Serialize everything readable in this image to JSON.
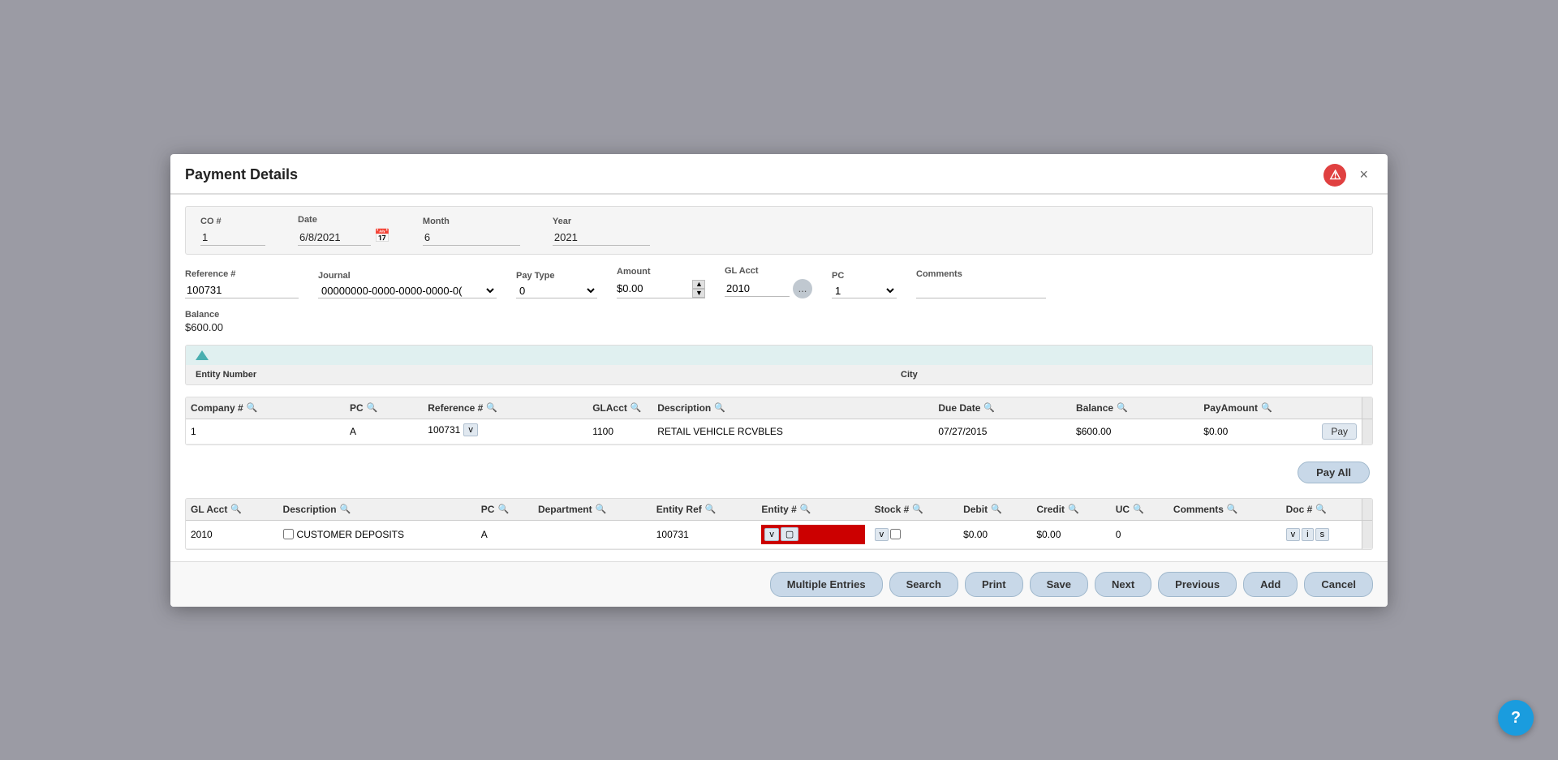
{
  "modal": {
    "title": "Payment Details",
    "close_label": "×"
  },
  "top_info": {
    "co_label": "CO #",
    "co_value": "1",
    "date_label": "Date",
    "date_value": "6/8/2021",
    "month_label": "Month",
    "month_value": "6",
    "year_label": "Year",
    "year_value": "2021"
  },
  "form": {
    "reference_label": "Reference #",
    "reference_value": "100731",
    "journal_label": "Journal",
    "journal_value": "00000000-0000-0000-0000-0(",
    "pay_type_label": "Pay Type",
    "pay_type_value": "0",
    "amount_label": "Amount",
    "amount_value": "$0.00",
    "gl_acct_label": "GL Acct",
    "gl_acct_value": "2010",
    "dots_label": "...",
    "pc_label": "PC",
    "pc_value": "1",
    "comments_label": "Comments",
    "comments_value": "",
    "balance_label": "Balance",
    "balance_value": "$600.00"
  },
  "entity_panel": {
    "entity_number_label": "Entity Number",
    "city_label": "City"
  },
  "top_table": {
    "columns": [
      {
        "key": "company_hash",
        "label": "Company #"
      },
      {
        "key": "pc",
        "label": "PC"
      },
      {
        "key": "reference_hash",
        "label": "Reference #"
      },
      {
        "key": "gl_acct",
        "label": "GLAcct"
      },
      {
        "key": "description",
        "label": "Description"
      },
      {
        "key": "due_date",
        "label": "Due Date"
      },
      {
        "key": "balance",
        "label": "Balance"
      },
      {
        "key": "pay_amount",
        "label": "PayAmount"
      }
    ],
    "rows": [
      {
        "company_hash": "1",
        "pc": "A",
        "reference_hash": "100731",
        "gl_acct": "1100",
        "description": "RETAIL VEHICLE RCVBLES",
        "due_date": "07/27/2015",
        "balance": "$600.00",
        "pay_amount": "$0.00",
        "pay_btn": "Pay"
      }
    ]
  },
  "pay_all_label": "Pay All",
  "bottom_table": {
    "columns": [
      {
        "key": "gl_acct",
        "label": "GL Acct"
      },
      {
        "key": "description",
        "label": "Description"
      },
      {
        "key": "pc",
        "label": "PC"
      },
      {
        "key": "department",
        "label": "Department"
      },
      {
        "key": "entity_ref",
        "label": "Entity Ref"
      },
      {
        "key": "entity_hash",
        "label": "Entity #"
      },
      {
        "key": "stock_hash",
        "label": "Stock #"
      },
      {
        "key": "debit",
        "label": "Debit"
      },
      {
        "key": "credit",
        "label": "Credit"
      },
      {
        "key": "uc",
        "label": "UC"
      },
      {
        "key": "comments",
        "label": "Comments"
      },
      {
        "key": "doc_hash",
        "label": "Doc #"
      }
    ],
    "rows": [
      {
        "gl_acct": "2010",
        "description": "CUSTOMER DEPOSITS",
        "pc": "A",
        "department": "",
        "entity_ref": "100731",
        "entity_ref_highlighted": true,
        "entity_hash": "",
        "stock_hash": "",
        "debit": "$0.00",
        "credit": "$0.00",
        "uc": "0",
        "comments": "",
        "doc_hash": ""
      }
    ]
  },
  "footer": {
    "multiple_entries_label": "Multiple Entries",
    "search_label": "Search",
    "print_label": "Print",
    "save_label": "Save",
    "next_label": "Next",
    "previous_label": "Previous",
    "add_label": "Add",
    "cancel_label": "Cancel"
  },
  "help_icon": "?"
}
